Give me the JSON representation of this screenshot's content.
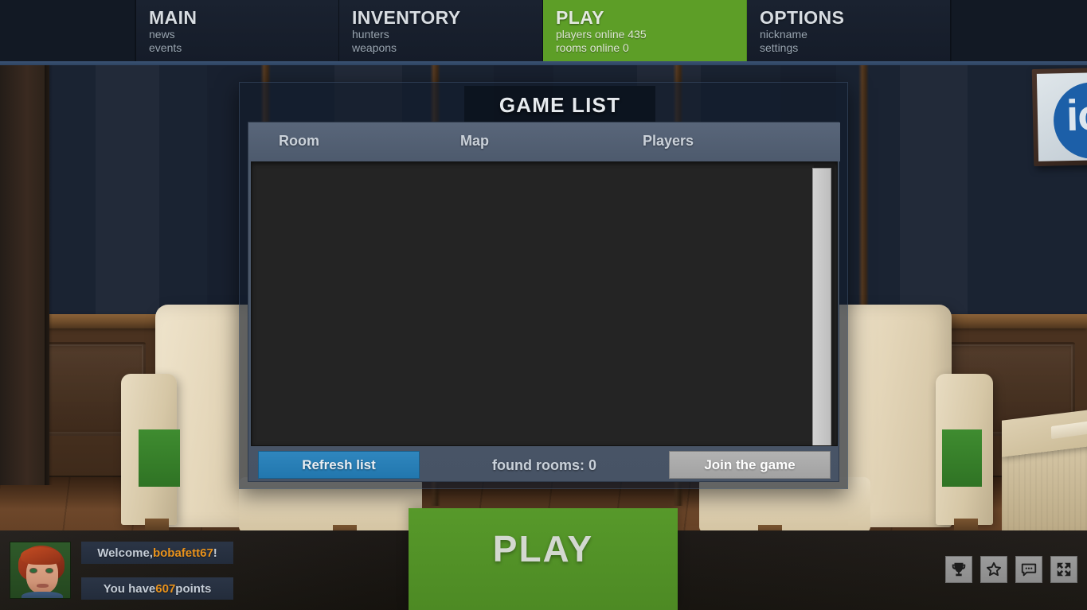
{
  "nav": {
    "tabs": [
      {
        "title": "MAIN",
        "sub1": "news",
        "sub2": "events",
        "active": false
      },
      {
        "title": "INVENTORY",
        "sub1": "hunters",
        "sub2": "weapons",
        "active": false
      },
      {
        "title": "PLAY",
        "sub1": "players online 435",
        "sub2": "rooms online 0",
        "active": true
      },
      {
        "title": "OPTIONS",
        "sub1": "nickname",
        "sub2": "settings",
        "active": false
      }
    ]
  },
  "dialog": {
    "title": "GAME LIST",
    "columns": {
      "room": "Room",
      "map": "Map",
      "players": "Players"
    },
    "rows": [],
    "footer": {
      "refresh_label": "Refresh list",
      "found_rooms": "found rooms: 0",
      "join_label": "Join the game"
    }
  },
  "play_button": {
    "label": "PLAY"
  },
  "status": {
    "welcome_prefix": "Welcome, ",
    "username": "bobafett67",
    "welcome_suffix": "!",
    "points_prefix": "You have ",
    "points": "607",
    "points_suffix": " points",
    "icons": [
      "trophy-icon",
      "star-icon",
      "chat-icon",
      "fullscreen-icon"
    ]
  },
  "scene": {
    "poster_text": "io"
  },
  "colors": {
    "accent_green": "#5d9e27",
    "refresh_blue": "#2277ae",
    "highlight_orange": "#e8921c",
    "nav_dark": "#151c29",
    "wall_blue": "#24547f"
  }
}
